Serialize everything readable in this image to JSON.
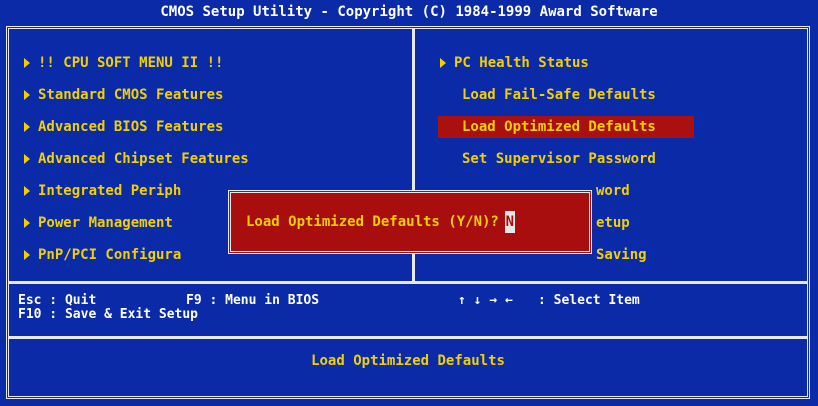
{
  "title": "CMOS Setup Utility - Copyright (C) 1984-1999 Award Software",
  "left_menu": [
    {
      "label": "!! CPU SOFT MENU II !!",
      "arrow": true
    },
    {
      "label": "Standard CMOS Features",
      "arrow": true
    },
    {
      "label": "Advanced BIOS Features",
      "arrow": true
    },
    {
      "label": "Advanced Chipset Features",
      "arrow": true
    },
    {
      "label": "Integrated Periph",
      "arrow": true
    },
    {
      "label": "Power Management",
      "arrow": true
    },
    {
      "label": "PnP/PCI Configura",
      "arrow": true
    }
  ],
  "right_menu": [
    {
      "label": "PC Health Status",
      "arrow": true
    },
    {
      "label": "Load Fail-Safe Defaults",
      "arrow": false
    },
    {
      "label": "Load Optimized Defaults",
      "arrow": false,
      "selected": true
    },
    {
      "label": "Set Supervisor Password",
      "arrow": false
    },
    {
      "label": "word",
      "arrow": false
    },
    {
      "label": "etup",
      "arrow": false
    },
    {
      "label": "Saving",
      "arrow": false
    }
  ],
  "dialog": {
    "prompt": "Load Optimized Defaults (Y/N)?",
    "answer": "N"
  },
  "help": {
    "line1_left": "Esc : Quit",
    "line1_mid": "F9 : Menu in BIOS",
    "line1_arrows": "↑ ↓ → ←",
    "line1_right": ": Select Item",
    "line2_left": "F10 : Save & Exit Setup"
  },
  "status_text": "Load Optimized Defaults",
  "colors": {
    "background": "#0a2aa8",
    "menu_text": "#f2d000",
    "highlight": "#aa1010",
    "dialog_bg": "#a80e0e",
    "frame": "#e8e8e8"
  }
}
